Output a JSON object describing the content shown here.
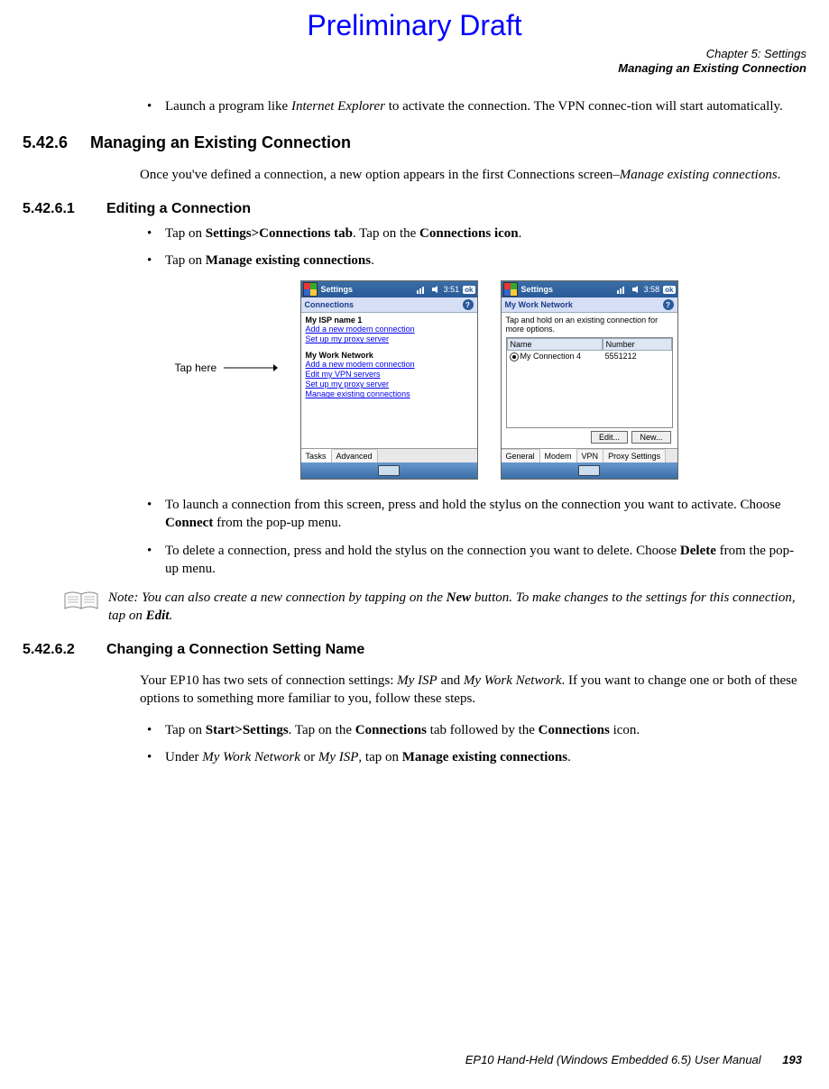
{
  "prelim": "Preliminary Draft",
  "running_head": {
    "chapter": "Chapter 5:  Settings",
    "section": "Managing an Existing Connection"
  },
  "intro_bullet": {
    "pre": "Launch a program like ",
    "em": "Internet Explorer",
    "post": " to activate the connection. The VPN connec-tion will start automatically."
  },
  "sec": {
    "num": "5.42.6",
    "title": "Managing an Existing Connection",
    "body_pre": "Once you've defined a connection, a new option appears in the first Connections screen–",
    "body_em": "Manage existing connections",
    "body_post": "."
  },
  "sub1": {
    "num": "5.42.6.1",
    "title": "Editing a Connection",
    "b1_pre": "Tap on ",
    "b1_bold1": "Settings>Connections tab",
    "b1_mid": ". Tap on the ",
    "b1_bold2": "Connections icon",
    "b1_post": ".",
    "b2_pre": "Tap on ",
    "b2_bold": "Manage existing connections",
    "b2_post": ".",
    "b3_pre": "To launch a connection from this screen, press and hold the stylus on the connection you want to activate. Choose ",
    "b3_bold": "Connect",
    "b3_post": " from the pop-up menu.",
    "b4_pre": "To delete a connection, press and hold the stylus on the connection you want to delete. Choose ",
    "b4_bold": "Delete",
    "b4_post": " from the pop-up menu."
  },
  "annotation": "Tap here",
  "shot1": {
    "title": "Settings",
    "time": "3:51",
    "ok": "ok",
    "subtitle": "Connections",
    "isp": "My ISP name 1",
    "isp_l1": "Add a new modem connection",
    "isp_l2": "Set up my proxy server",
    "work": "My Work Network",
    "w_l1": "Add a new modem connection",
    "w_l2": "Edit my VPN servers",
    "w_l3": "Set up my proxy server",
    "w_l4": "Manage existing connections",
    "tab1": "Tasks",
    "tab2": "Advanced"
  },
  "shot2": {
    "title": "Settings",
    "time": "3:58",
    "ok": "ok",
    "subtitle": "My Work Network",
    "instr": "Tap and hold on an existing connection for more options.",
    "col1": "Name",
    "col2": "Number",
    "row_name": "My Connection 4",
    "row_num": "5551212",
    "btn_edit": "Edit...",
    "btn_new": "New...",
    "t1": "General",
    "t2": "Modem",
    "t3": "VPN",
    "t4": "Proxy Settings"
  },
  "note": {
    "lead": "Note: ",
    "pre": "You can also create a new connection by tapping on the ",
    "b1": "New",
    "mid": " button. To make changes to the settings for this connection, tap on ",
    "b2": "Edit",
    "post": "."
  },
  "sub2": {
    "num": "5.42.6.2",
    "title": "Changing a Connection Setting Name",
    "p_pre": "Your EP10 has two sets of connection settings: ",
    "p_em1": "My ISP",
    "p_mid1": " and ",
    "p_em2": "My Work Network",
    "p_post": ". If you want to change one or both of these options to something more familiar to you, follow these steps.",
    "b1_pre": "Tap on ",
    "b1_bold1": "Start>Settings",
    "b1_mid1": ". Tap on the ",
    "b1_bold2": "Connections",
    "b1_mid2": " tab followed by the ",
    "b1_bold3": "Connections",
    "b1_post": " icon.",
    "b2_pre": "Under ",
    "b2_em1": "My Work Network",
    "b2_mid": " or ",
    "b2_em2": "My ISP",
    "b2_mid2": ", tap on ",
    "b2_bold": "Manage existing connections",
    "b2_post": "."
  },
  "footer": {
    "text": "EP10 Hand-Held (Windows Embedded 6.5) User Manual",
    "page": "193"
  }
}
